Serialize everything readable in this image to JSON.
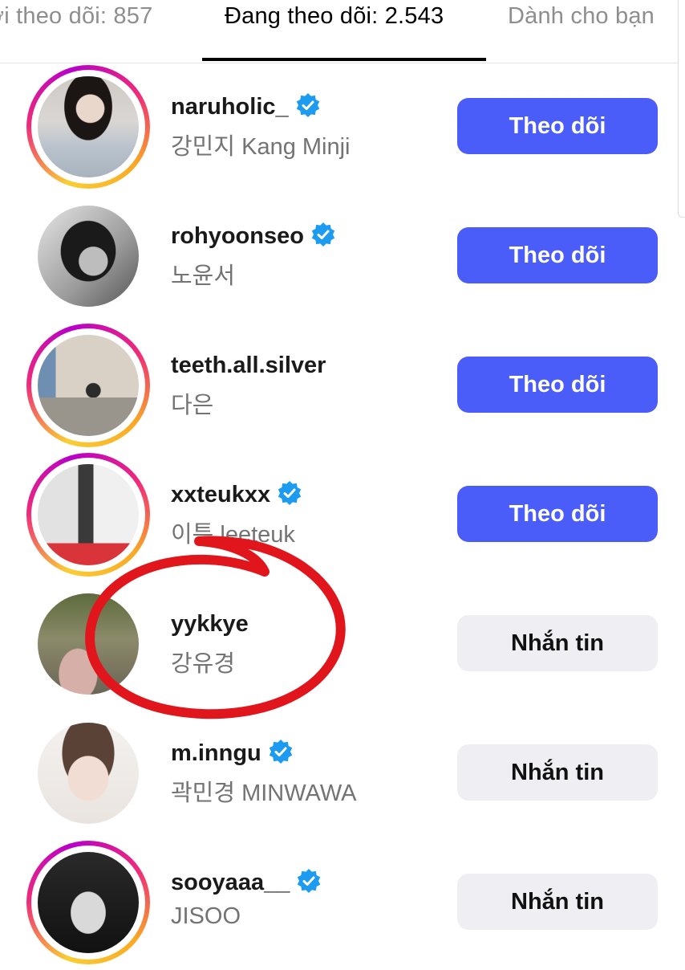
{
  "tabs": {
    "followers": "ời theo dõi: 857",
    "following": "Đang theo dõi: 2.543",
    "for_you": "Dành cho bạn"
  },
  "accounts": [
    {
      "username": "naruholic_",
      "name": "강민지 Kang Minji",
      "verified": true,
      "button": "Theo dõi"
    },
    {
      "username": "rohyoonseo",
      "name": "노윤서",
      "verified": true,
      "button": "Theo dõi"
    },
    {
      "username": "teeth.all.silver",
      "name": "다은",
      "verified": false,
      "button": "Theo dõi"
    },
    {
      "username": "xxteukxx",
      "name": "이특 leeteuk",
      "verified": true,
      "button": "Theo dõi"
    },
    {
      "username": "yykkye",
      "name": "강유경",
      "verified": false,
      "button": "Nhắn tin"
    },
    {
      "username": "m.inngu",
      "name": "곽민경 MINWAWA",
      "verified": true,
      "button": "Nhắn tin"
    },
    {
      "username": "sooyaaa__",
      "name": "JISOO",
      "verified": true,
      "button": "Nhắn tin"
    }
  ],
  "colors": {
    "follow_button": "#4a5df9",
    "message_button": "#efeff3",
    "verified_badge": "#1d9bf0",
    "annotation": "#e0161c"
  }
}
